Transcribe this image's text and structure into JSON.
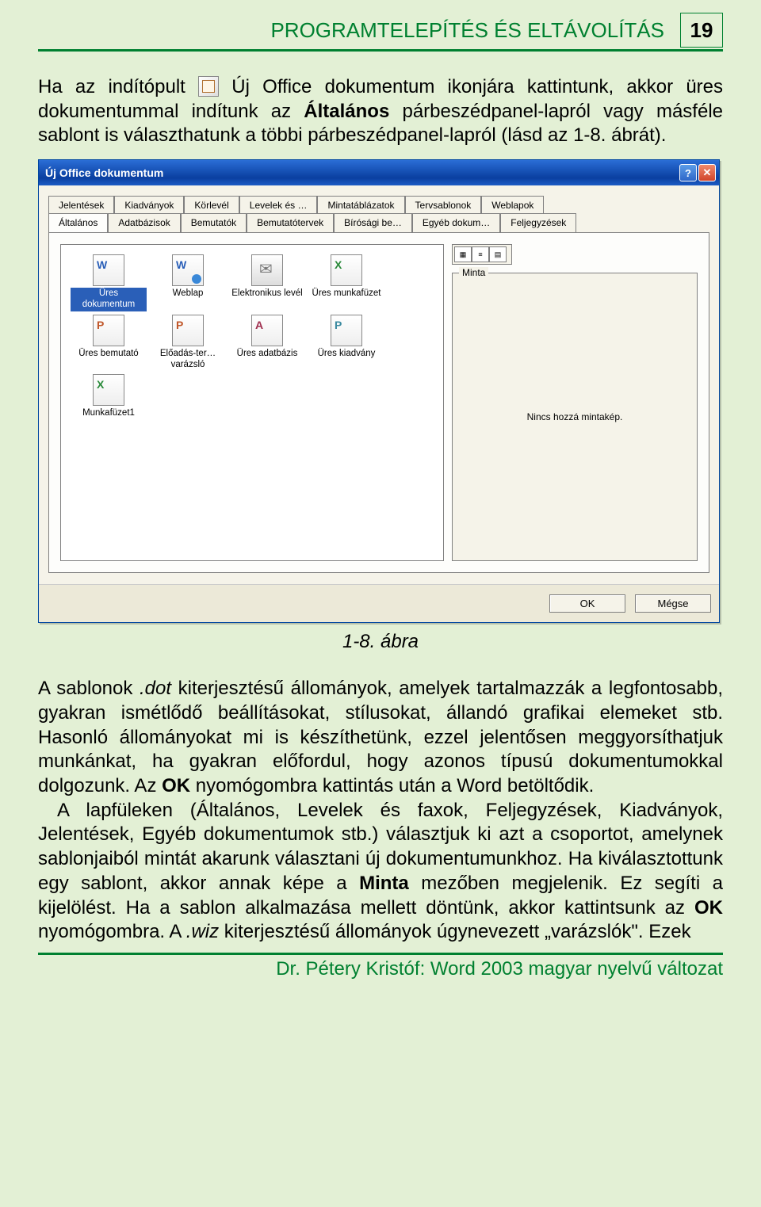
{
  "header": {
    "title": "PROGRAMTELEPÍTÉS ÉS ELTÁVOLÍTÁS",
    "page_number": "19"
  },
  "para1_prefix": "Ha az indítópult ",
  "para1_mid1": " Új Office dokumentum ikonjára kattintunk, akkor üres dokumentummal indítunk az ",
  "para1_bold1": "Általános",
  "para1_mid2": " párbeszédpanel-lapról vagy másféle sablont is választhatunk a többi párbeszédpanel-lapról (lásd az 1-8. ábrát).",
  "dialog": {
    "title": "Új Office dokumentum",
    "tabs_row1": [
      "Jelentések",
      "Kiadványok",
      "Körlevél",
      "Levelek és …",
      "Mintatáblázatok",
      "Tervsablonok",
      "Weblapok"
    ],
    "tabs_row2": [
      "Általános",
      "Adatbázisok",
      "Bemutatók",
      "Bemutatótervek",
      "Bírósági be…",
      "Egyéb dokum…",
      "Feljegyzések"
    ],
    "active_tab": "Általános",
    "icons": [
      {
        "label": "Üres dokumentum",
        "pic": "word",
        "selected": true
      },
      {
        "label": "Weblap",
        "pic": "web"
      },
      {
        "label": "Elektronikus levél",
        "pic": "mail"
      },
      {
        "label": "Üres munkafüzet",
        "pic": "excel"
      },
      {
        "label": "Üres bemutató",
        "pic": "ppt"
      },
      {
        "label": "Előadás-ter… varázsló",
        "pic": "ppt"
      },
      {
        "label": "Üres adatbázis",
        "pic": "access"
      },
      {
        "label": "Üres kiadvány",
        "pic": "pub"
      },
      {
        "label": "Munkafüzet1",
        "pic": "excel"
      }
    ],
    "preview_label": "Minta",
    "preview_text": "Nincs hozzá mintakép.",
    "ok": "OK",
    "cancel": "Mégse"
  },
  "caption": "1-8. ábra",
  "para2_a": "A sablonok ",
  "para2_i1": ".dot",
  "para2_b": " kiterjesztésű állományok, amelyek tartalmazzák a legfontosabb, gyakran ismétlődő beállításokat, stílusokat, állandó grafikai elemeket stb. Hasonló állományokat mi is készíthetünk, ezzel jelentősen meggyorsíthatjuk munkánkat, ha gyakran előfordul, hogy azonos típusú dokumentumokkal dolgozunk. Az ",
  "para2_bold1": "OK",
  "para2_c": " nyomógombra kattintás után a Word betöltődik.",
  "para3_a": "A lapfüleken (Általános, Levelek és faxok, Feljegyzések, Kiadványok, Jelentések, Egyéb dokumentumok stb.) választjuk ki azt a csoportot, amelynek sablonjaiból mintát akarunk választani új dokumentumunkhoz. Ha kiválasztottunk egy sablont, akkor annak képe a ",
  "para3_bold1": "Minta",
  "para3_b": " mezőben megjelenik. Ez segíti a kijelölést. Ha a sablon alkalmazása mellett döntünk, akkor kattintsunk az ",
  "para3_bold2": "OK",
  "para3_c": " nyomógombra. A ",
  "para3_i1": ".wiz",
  "para3_d": " kiterjesztésű állományok úgynevezett „varázslók\". Ezek",
  "footer": "Dr. Pétery Kristóf: Word 2003 magyar nyelvű változat"
}
